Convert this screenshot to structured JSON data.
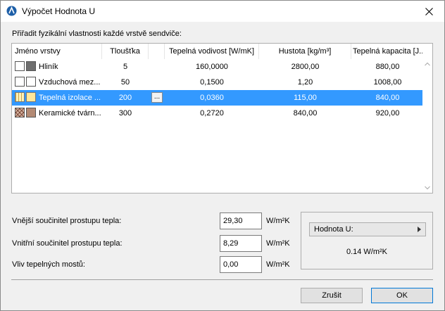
{
  "window": {
    "title": "Výpočet Hodnota U"
  },
  "instruction": "Přiřadit fyzikální vlastnosti každé vrstvě sendviče:",
  "table": {
    "columns": [
      "Jméno vrstvy",
      "Tloušťka",
      "Tepelná vodivost [W/mK]",
      "Hustota [kg/m³]",
      "Tepelná kapacita [J..."
    ],
    "rows": [
      {
        "name": "Hliník",
        "thickness": "5",
        "conductivity": "160,0000",
        "density": "2800,00",
        "capacity": "880,00"
      },
      {
        "name": "Vzduchová mez...",
        "thickness": "50",
        "conductivity": "0,1500",
        "density": "1,20",
        "capacity": "1008,00"
      },
      {
        "name": "Tepelná izolace ...",
        "thickness": "200",
        "conductivity": "0,0360",
        "density": "115,00",
        "capacity": "840,00",
        "button": "..."
      },
      {
        "name": "Keramické tvárn...",
        "thickness": "300",
        "conductivity": "0,2720",
        "density": "840,00",
        "capacity": "920,00"
      }
    ]
  },
  "fields": {
    "outer": {
      "label": "Vnější součinitel prostupu tepla:",
      "value": "29,30",
      "unit": "W/m²K"
    },
    "inner": {
      "label": "Vnitřní součinitel prostupu tepla:",
      "value": "8,29",
      "unit": "W/m²K"
    },
    "bridges": {
      "label": "Vliv tepelných mostů:",
      "value": "0,00",
      "unit": "W/m²K"
    }
  },
  "uvalue": {
    "dropdown_label": "Hodnota U:",
    "result": "0.14 W/m²K"
  },
  "buttons": {
    "cancel": "Zrušit",
    "ok": "OK"
  },
  "colors": {
    "selection": "#3399ff",
    "accent": "#0078d7"
  }
}
